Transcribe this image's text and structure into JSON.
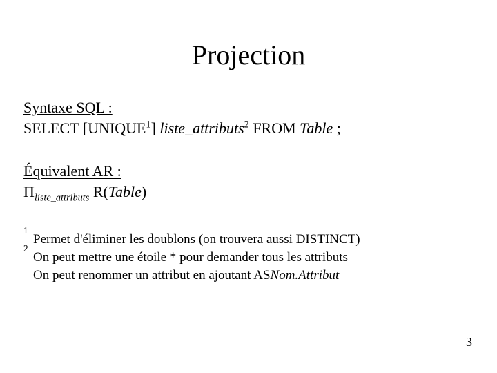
{
  "title": "Projection",
  "syntax": {
    "label": "Syntaxe SQL :",
    "select": "SELECT [UNIQUE",
    "sup1": "1",
    "bracket_close": "] ",
    "liste_attr": "liste_attributs",
    "sup2": "2",
    "from": " FROM ",
    "table": "Table",
    "semicolon": " ;"
  },
  "equiv": {
    "label": "Équivalent AR :",
    "pi": "Π",
    "sub": "liste_attributs",
    "r_open": " R(",
    "table": "Table",
    "r_close": ")"
  },
  "footnotes": {
    "n1": "1",
    "t1": "Permet d'éliminer les doublons (on trouvera aussi DISTINCT)",
    "n2": "2",
    "t2": "On peut mettre une étoile * pour demander tous les attributs",
    "t3a": "On peut renommer un attribut en ajoutant AS ",
    "t3b": "Nom.Attribut"
  },
  "page_number": "3"
}
